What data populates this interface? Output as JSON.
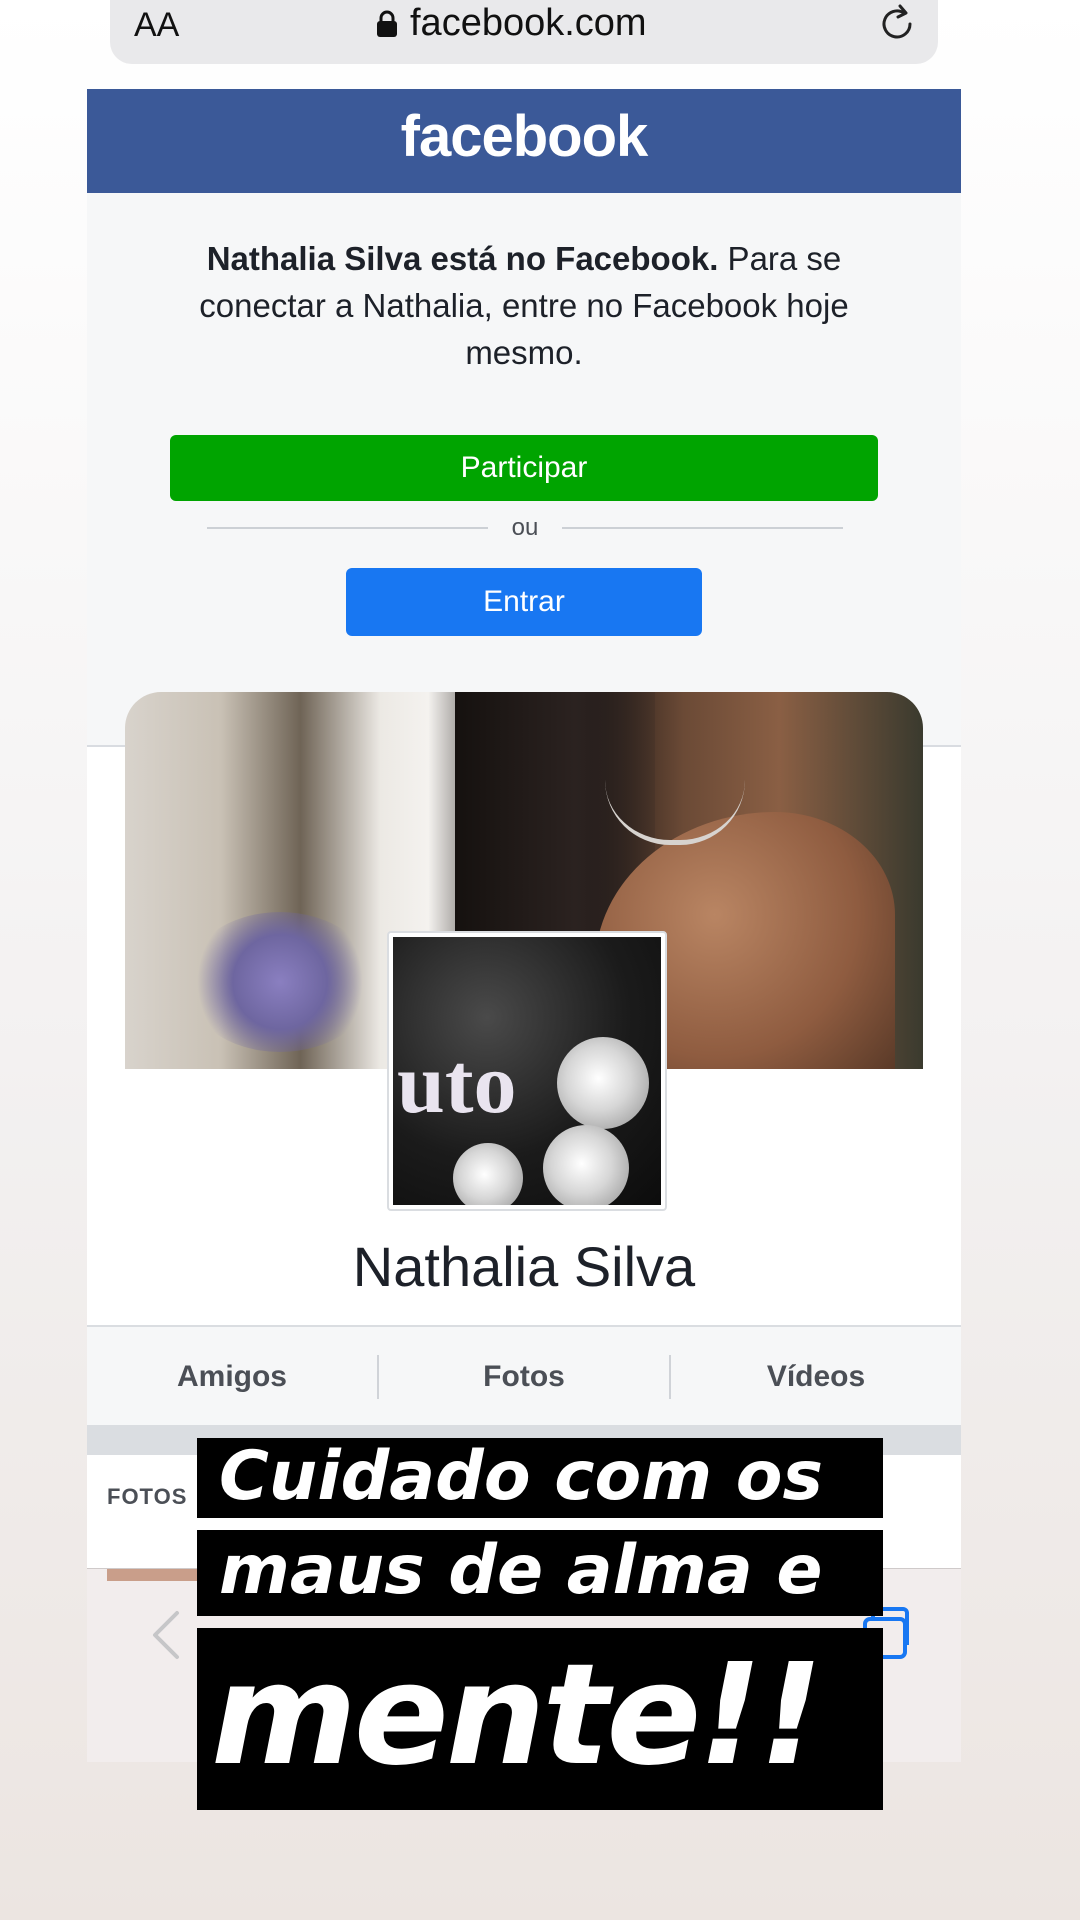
{
  "browser": {
    "text_size_label": "AA",
    "url": "facebook.com"
  },
  "facebook": {
    "logo": "facebook",
    "notice_bold": "Nathalia Silva está no Facebook.",
    "notice_rest": " Para se conectar a Nathalia, entre no Facebook hoje mesmo.",
    "join_button": "Participar",
    "or_text": "ou",
    "login_button": "Entrar"
  },
  "profile": {
    "avatar_text": "uto",
    "name": "Nathalia Silva",
    "tabs": [
      "Amigos",
      "Fotos",
      "Vídeos"
    ],
    "photos_header": "FOTOS"
  },
  "caption": {
    "line1": "Cuidado com os",
    "line2": "maus de alma e",
    "line3": "mente!!"
  }
}
